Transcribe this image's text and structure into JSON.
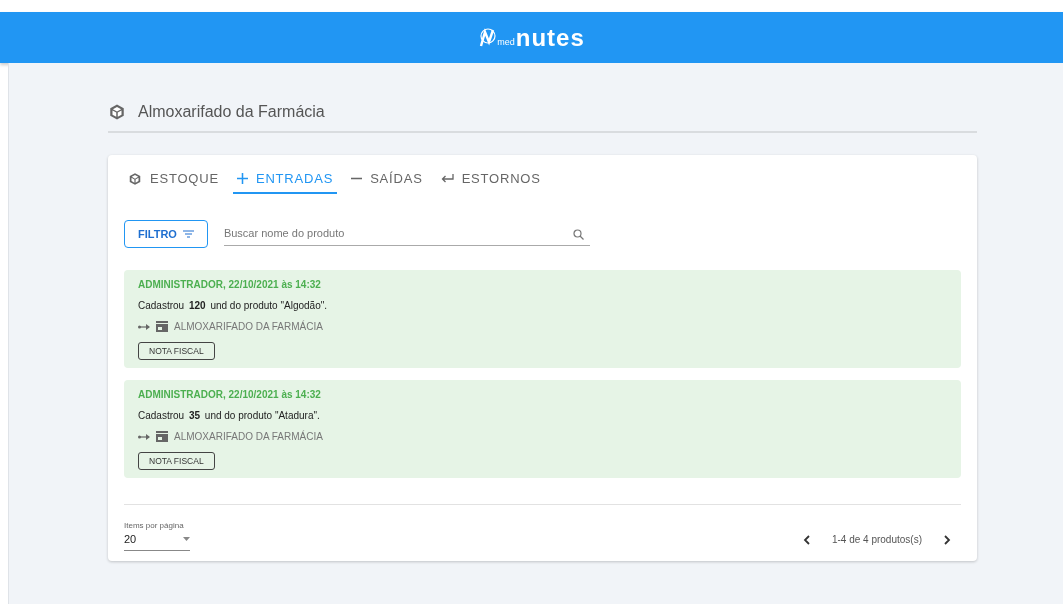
{
  "header": {
    "logo_small": "med",
    "logo_text": "nutes"
  },
  "page_title": "Almoxarifado da Farmácia",
  "tabs": [
    {
      "label": "ESTOQUE",
      "kind": "box",
      "selected": false
    },
    {
      "label": "ENTRADAS",
      "kind": "plus",
      "selected": true
    },
    {
      "label": "SAÍDAS",
      "kind": "minus",
      "selected": false
    },
    {
      "label": "ESTORNOS",
      "kind": "return",
      "selected": false
    }
  ],
  "filter_button": "FILTRO",
  "search": {
    "placeholder": "Buscar nome do produto"
  },
  "entries": [
    {
      "author": "ADMINISTRADOR, 22/10/2021 às 14:32",
      "text": "Cadastrou **120** und do produto \"Algodão\".",
      "location": "ALMOXARIFADO DA FARMÁCIA",
      "button": "NOTA FISCAL"
    },
    {
      "author": "ADMINISTRADOR, 22/10/2021 às 14:32",
      "text": "Cadastrou **35** und do produto \"Atadura\".",
      "location": "ALMOXARIFADO DA FARMÁCIA",
      "button": "NOTA FISCAL"
    }
  ],
  "pagination": {
    "per_page_label": "Items por página",
    "per_page_value": "20",
    "range": "1-4 de 4 produtos(s)"
  }
}
